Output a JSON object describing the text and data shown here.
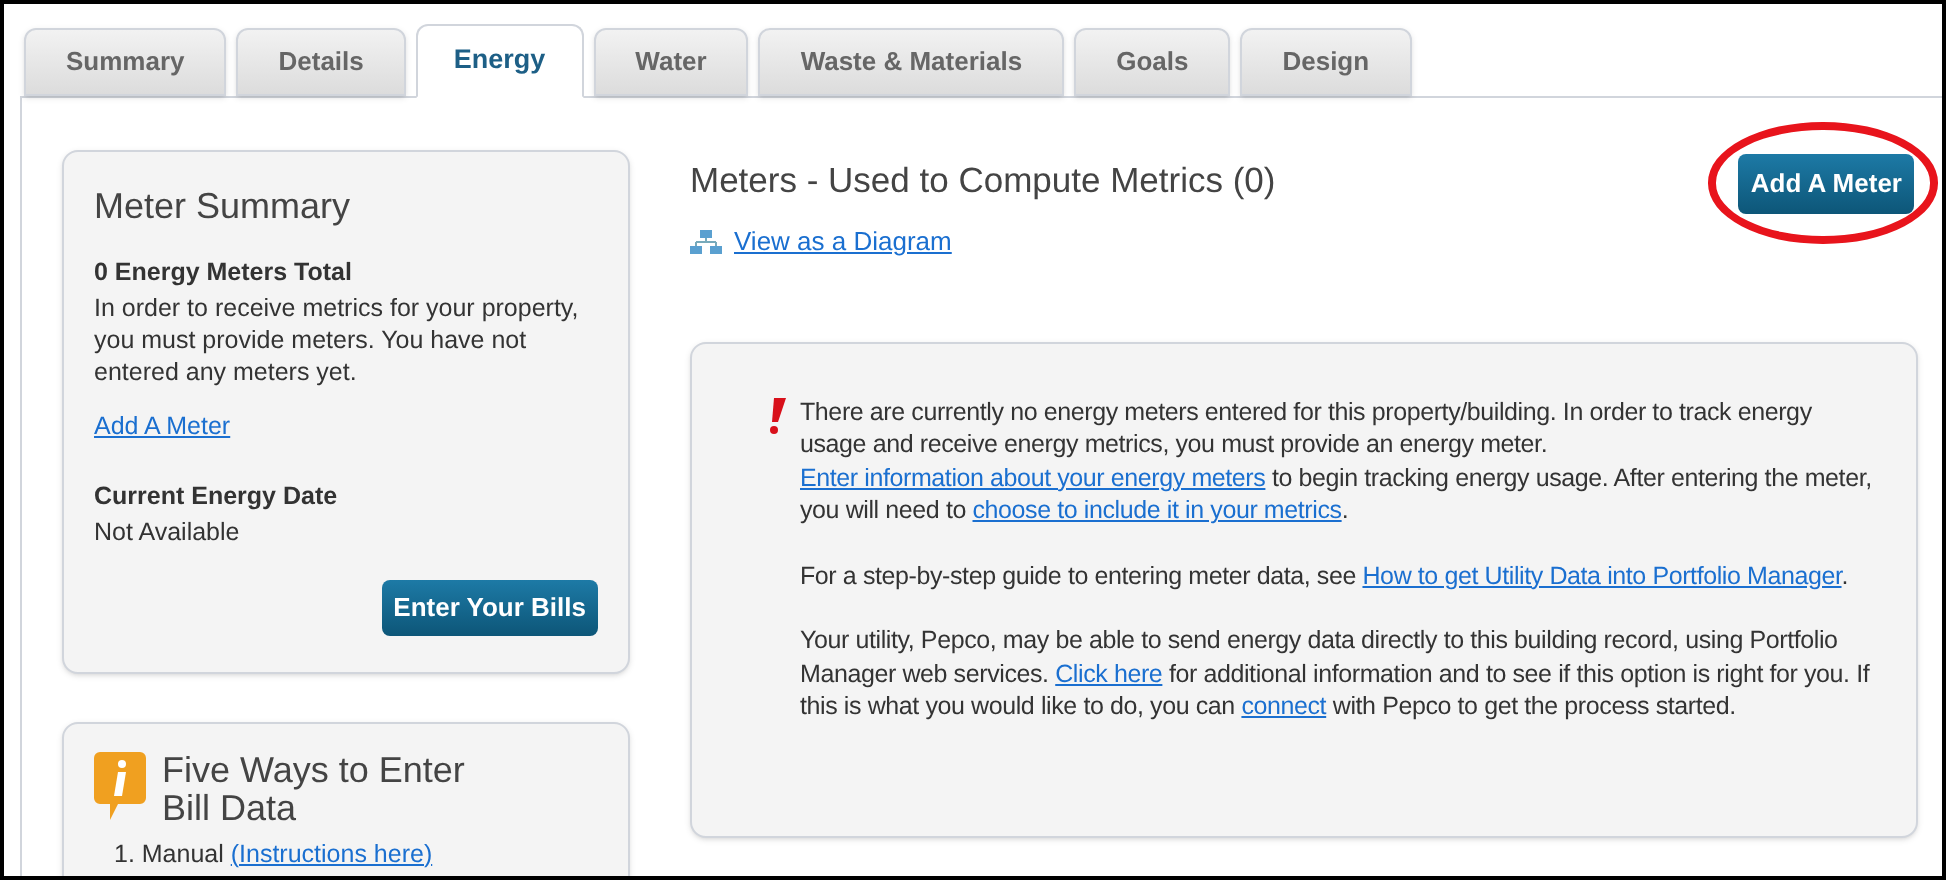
{
  "tabs": [
    {
      "label": "Summary",
      "selected": false
    },
    {
      "label": "Details",
      "selected": false
    },
    {
      "label": "Energy",
      "selected": true
    },
    {
      "label": "Water",
      "selected": false
    },
    {
      "label": "Waste & Materials",
      "selected": false
    },
    {
      "label": "Goals",
      "selected": false
    },
    {
      "label": "Design",
      "selected": false
    }
  ],
  "meter_summary": {
    "title": "Meter Summary",
    "total": "0 Energy Meters Total",
    "description": "In order to receive metrics for your property, you must provide meters. You have not entered any meters yet.",
    "add_link": "Add A Meter",
    "date_label": "Current Energy Date",
    "date_value": "Not Available",
    "button": "Enter Your Bills"
  },
  "five_ways": {
    "title": "Five Ways to Enter Bill Data",
    "items": [
      [
        {
          "kind": "text",
          "text": "1. Manual "
        },
        {
          "kind": "link",
          "text": "(Instructions here)"
        }
      ]
    ]
  },
  "meters": {
    "title": "Meters - Used to Compute Metrics (0)",
    "diagram_link": "View as a Diagram",
    "add_button": {
      "label": "Add A Meter",
      "circled": true
    }
  },
  "notice": {
    "paragraphs": [
      [
        {
          "kind": "text",
          "text": "There are currently no energy meters entered for this property/building. In order to track energy usage and receive energy metrics, you must provide an energy meter. "
        },
        {
          "kind": "link",
          "text": "Enter information about your energy meters"
        },
        {
          "kind": "text",
          "text": " to begin tracking energy usage. After entering the meter, you will need to "
        },
        {
          "kind": "link",
          "text": "choose to include it in your metrics"
        },
        {
          "kind": "text",
          "text": "."
        }
      ],
      [
        {
          "kind": "text",
          "text": "For a step-by-step guide to entering meter data, see "
        },
        {
          "kind": "link",
          "text": "How to get Utility Data into Portfolio Manager"
        },
        {
          "kind": "text",
          "text": "."
        }
      ],
      [
        {
          "kind": "text",
          "text": "Your utility, Pepco, may be able to send energy data directly to this building record, using Portfolio Manager web services. "
        },
        {
          "kind": "link",
          "text": "Click here"
        },
        {
          "kind": "text",
          "text": " for additional information and to see if this option is right for you. If this is what you would like to do, you can "
        },
        {
          "kind": "link",
          "text": "connect"
        },
        {
          "kind": "text",
          "text": " with Pepco to get the process started."
        }
      ]
    ]
  }
}
